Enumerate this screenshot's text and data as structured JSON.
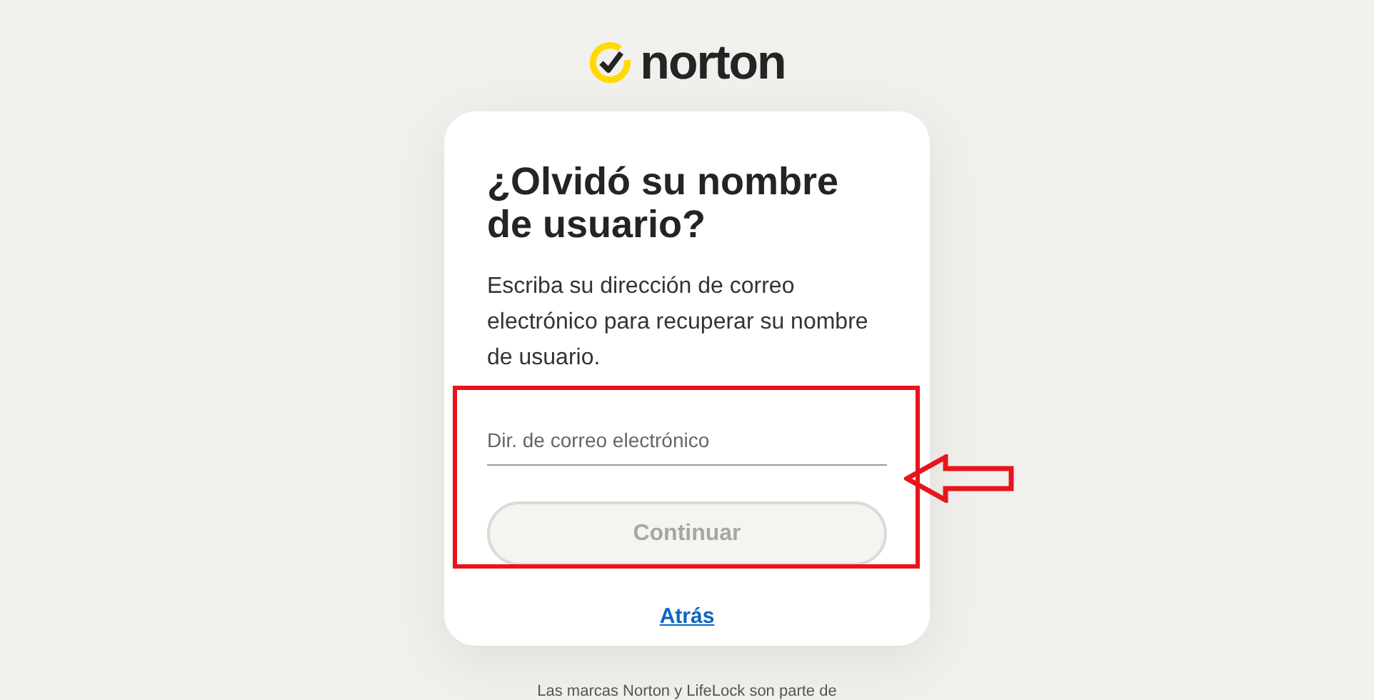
{
  "logo": {
    "text": "norton"
  },
  "card": {
    "title": "¿Olvidó su nombre de usuario?",
    "description": "Escriba su dirección de correo electrónico para recuperar su nombre de usuario.",
    "email_field": {
      "placeholder": "Dir. de correo electrónico"
    },
    "continue_button": {
      "label": "Continuar",
      "disabled": true
    },
    "back_link": "Atrás"
  },
  "footer": "Las marcas Norton y LifeLock son parte de"
}
